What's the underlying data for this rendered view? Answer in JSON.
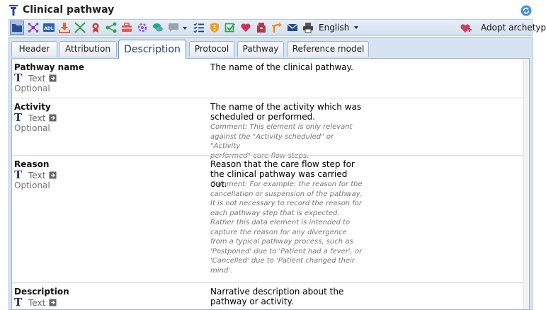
{
  "window": {
    "title": "Clinical pathway"
  },
  "toolbar": {
    "icons": [
      "folder-icon",
      "mindmap-icon",
      "adl-icon",
      "download-icon",
      "collapse-icon",
      "award-icon",
      "share-icon",
      "toolbox-icon",
      "settings-cycle-icon",
      "chat-icon",
      "comment-dropdown-icon",
      "checklist-icon",
      "warning-shield-icon",
      "checkbox-icon",
      "heart-icon",
      "archive-box-icon",
      "fork-icon",
      "mail-icon",
      "print-icon"
    ],
    "language": "English",
    "adopt_label": "Adopt archetype"
  },
  "tabs": [
    {
      "label": "Header"
    },
    {
      "label": "Attribution"
    },
    {
      "label": "Description"
    },
    {
      "label": "Protocol"
    },
    {
      "label": "Pathway"
    },
    {
      "label": "Reference model"
    }
  ],
  "active_tab": "Description",
  "rows": [
    {
      "name": "Pathway name",
      "type": "Text",
      "occurrence": "Optional",
      "description_lines": [
        "The name of the clinical pathway."
      ],
      "comment_lines": []
    },
    {
      "name": "Activity",
      "type": "Text",
      "occurrence": "Optional",
      "description_lines": [
        "The name of the activity which was",
        "scheduled or performed."
      ],
      "comment_lines": [
        "Comment: This element is only relevant",
        "against the \"Activity scheduled\" or \"Activity",
        "performed\" care flow steps."
      ]
    },
    {
      "name": "Reason",
      "type": "Text",
      "occurrence": "Optional",
      "description_lines": [
        "Reason that the care flow step for",
        "the clinical pathway was carried out."
      ],
      "comment_lines": [
        "Comment: For example: the reason for the",
        "cancellation or suspension of the pathway.",
        "It is not necessary to record the reason for",
        "each pathway step that is expected.",
        "Rather this data element is intended to",
        "capture the reason for any divergence",
        "from a typical pathway process, such as",
        "'Postponed' due to 'Patient had a fever', or",
        "'Cancelled' due to 'Patient changed their",
        "mind'."
      ]
    },
    {
      "name": "Description",
      "type": "Text",
      "occurrence": "",
      "description_lines": [
        "Narrative description about the",
        "pathway or activity."
      ],
      "comment_lines": []
    }
  ]
}
